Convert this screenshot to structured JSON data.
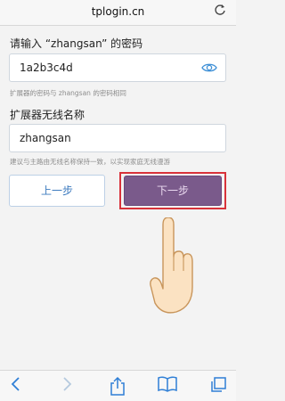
{
  "browser": {
    "url": "tplogin.cn",
    "reload_icon": "reload-icon",
    "toolbar": {
      "back_icon": "chevron-left-icon",
      "forward_icon": "chevron-right-icon",
      "share_icon": "share-icon",
      "bookmarks_icon": "book-icon",
      "tabs_icon": "tabs-icon"
    }
  },
  "form": {
    "password_label": "请输入 “zhangsan” 的密码",
    "password_value": "1a2b3c4d",
    "password_hint": "扩展器的密码与 zhangsan 的密码相同",
    "ssid_label": "扩展器无线名称",
    "ssid_value": "zhangsan",
    "ssid_hint": "建议与主路由无线名称保持一致，以实现家庭无线漫游",
    "prev_button": "上一步",
    "next_button": "下一步"
  },
  "colors": {
    "accent_blue": "#3d7bbf",
    "next_button_bg": "#7a5a8b",
    "highlight_border": "#d8323a",
    "toolbar_blue": "#2f7fd6"
  }
}
